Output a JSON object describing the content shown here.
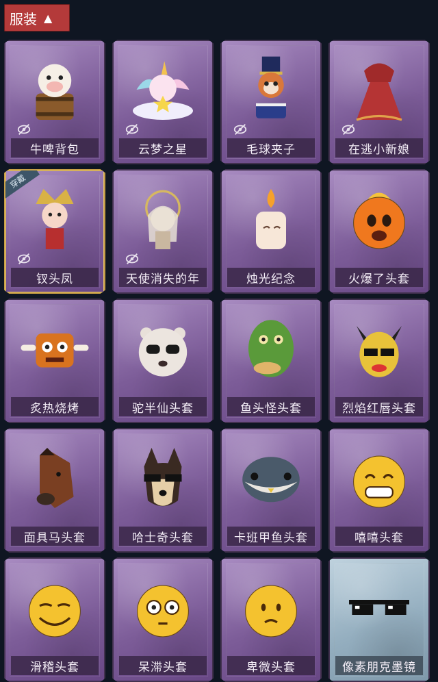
{
  "category": {
    "label": "服装",
    "icon": "chevron-up-icon"
  },
  "items": [
    {
      "name": "牛啤背包",
      "hidden": true,
      "art": "cow-mug"
    },
    {
      "name": "云梦之星",
      "hidden": true,
      "art": "unicorn-cloud"
    },
    {
      "name": "毛球夹子",
      "hidden": true,
      "art": "raccoon-drummer"
    },
    {
      "name": "在逃小新娘",
      "hidden": true,
      "art": "bride-dress"
    },
    {
      "name": "钗头凤",
      "hidden": true,
      "equipped": true,
      "badge": "穿戴",
      "art": "phoenix-crown-doll"
    },
    {
      "name": "天使消失的年",
      "hidden": true,
      "art": "angel-doll"
    },
    {
      "name": "烛光纪念",
      "hidden": false,
      "art": "candle"
    },
    {
      "name": "火爆了头套",
      "hidden": false,
      "art": "fire-head"
    },
    {
      "name": "炙热烧烤",
      "hidden": false,
      "art": "bbq-head"
    },
    {
      "name": "驼半仙头套",
      "hidden": false,
      "art": "sunglasses-animal-head"
    },
    {
      "name": "鱼头怪头套",
      "hidden": false,
      "art": "fish-head"
    },
    {
      "name": "烈焰红唇头套",
      "hidden": false,
      "art": "yellow-mask"
    },
    {
      "name": "面具马头套",
      "hidden": false,
      "art": "horse-head"
    },
    {
      "name": "哈士奇头套",
      "hidden": false,
      "art": "husky-head"
    },
    {
      "name": "卡班甲鱼头套",
      "hidden": false,
      "art": "turtle-head"
    },
    {
      "name": "嘻嘻头套",
      "hidden": false,
      "art": "grin-emoji"
    },
    {
      "name": "滑稽头套",
      "hidden": false,
      "art": "funny-emoji"
    },
    {
      "name": "呆滞头套",
      "hidden": false,
      "art": "dazed-emoji"
    },
    {
      "name": "卑微头套",
      "hidden": false,
      "art": "humble-emoji"
    },
    {
      "name": "像素朋克墨镜",
      "hidden": false,
      "rare": true,
      "art": "pixel-sunglasses"
    }
  ]
}
